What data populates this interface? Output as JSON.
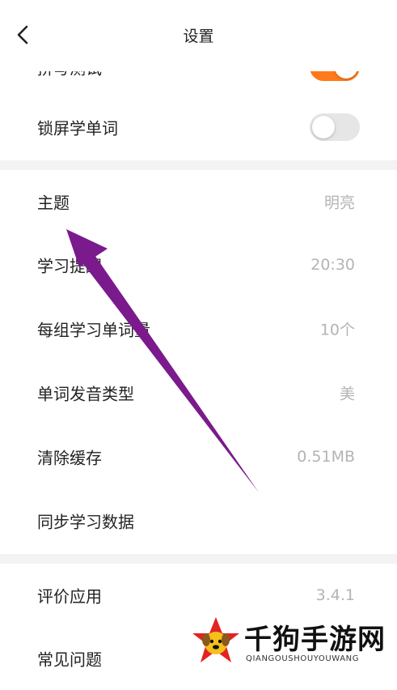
{
  "header": {
    "title": "设置",
    "back_icon": "chevron-left-icon"
  },
  "settings": {
    "group1": [
      {
        "label": "拼写测试",
        "toggle": true
      },
      {
        "label": "锁屏学单词",
        "toggle": false
      }
    ],
    "group2": [
      {
        "label": "主题",
        "value": "明亮"
      },
      {
        "label": "学习提醒",
        "value": "20:30"
      },
      {
        "label": "每组学习单词量",
        "value": "10个"
      },
      {
        "label": "单词发音类型",
        "value": "美"
      },
      {
        "label": "清除缓存",
        "value": "0.51MB"
      },
      {
        "label": "同步学习数据",
        "value": ""
      }
    ],
    "group3": [
      {
        "label": "评价应用",
        "value": "3.4.1"
      },
      {
        "label": "常见问题",
        "value": ""
      }
    ]
  },
  "colors": {
    "toggle_on": "#ff7a1a",
    "toggle_off": "#e6e6e6",
    "annotation_arrow": "#7a1a8c",
    "divider": "#f3f3f3"
  },
  "watermark": {
    "text": "千狗手游网",
    "subtext": "QIANGOUSHOUYOUWANG"
  }
}
